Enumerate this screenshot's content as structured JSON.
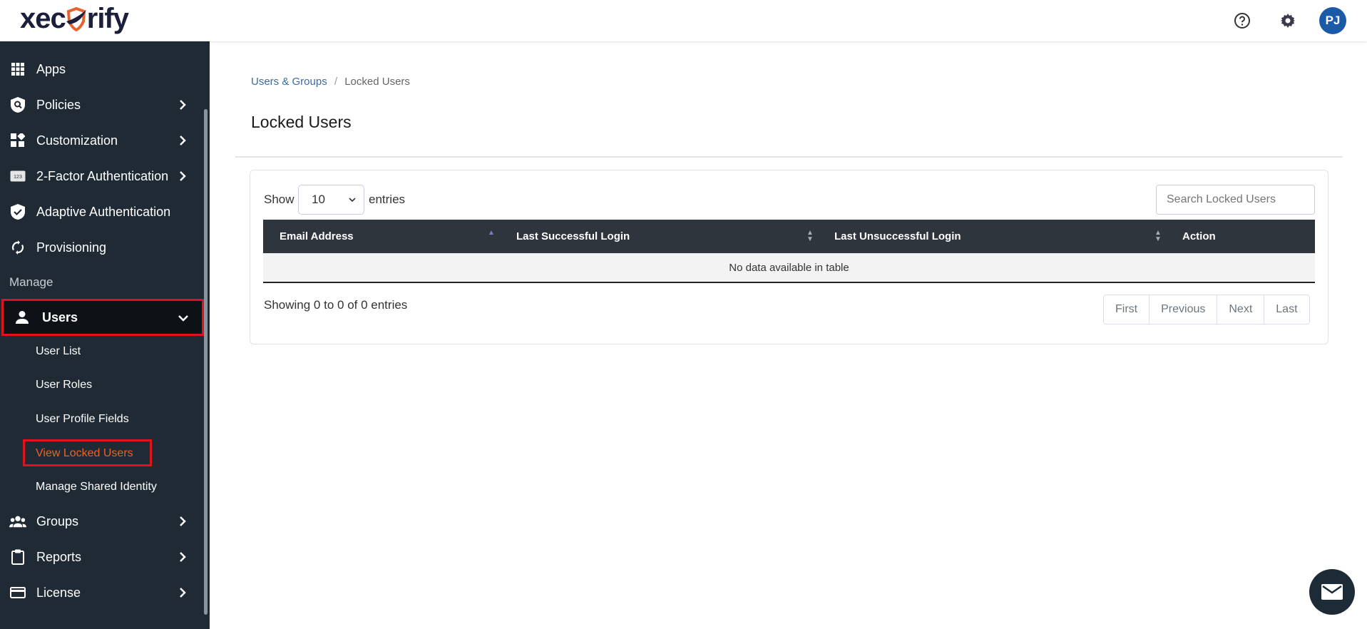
{
  "header": {
    "logo": "xecurify",
    "logo_left": "xec",
    "logo_right": "rify",
    "avatar_initials": "PJ"
  },
  "sidebar": {
    "items": [
      {
        "label": "Apps",
        "icon": "grid-icon"
      },
      {
        "label": "Policies",
        "icon": "policy-shield-icon"
      },
      {
        "label": "Customization",
        "icon": "widgets-icon"
      },
      {
        "label": "2-Factor Authentication",
        "icon": "123-icon"
      },
      {
        "label": "Adaptive Authentication",
        "icon": "verified-shield-icon"
      },
      {
        "label": "Provisioning",
        "icon": "sync-icon"
      }
    ],
    "section": "Manage",
    "users": {
      "label": "Users",
      "sub": [
        "User List",
        "User Roles",
        "User Profile Fields",
        "View Locked Users",
        "Manage Shared Identity"
      ]
    },
    "bottom": [
      {
        "label": "Groups"
      },
      {
        "label": "Reports"
      },
      {
        "label": "License"
      }
    ]
  },
  "breadcrumb": {
    "parent": "Users & Groups",
    "sep": "/",
    "current": "Locked Users"
  },
  "page_title": "Locked Users",
  "table": {
    "show": "Show",
    "entries": "entries",
    "page_size": "10",
    "search_placeholder": "Search Locked Users",
    "columns": [
      "Email Address",
      "Last Successful Login",
      "Last Unsuccessful Login",
      "Action"
    ],
    "empty": "No data available in table",
    "info": "Showing 0 to 0 of 0 entries",
    "pagination": [
      "First",
      "Previous",
      "Next",
      "Last"
    ]
  },
  "colors": {
    "accent": "#e8622a",
    "sidebar": "#1f2a35",
    "avatar": "#1a5aa6"
  }
}
